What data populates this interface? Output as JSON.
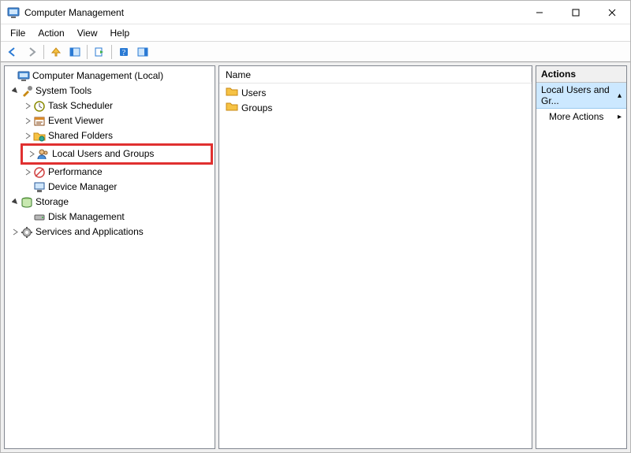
{
  "window": {
    "title": "Computer Management"
  },
  "menu": {
    "file": "File",
    "action": "Action",
    "view": "View",
    "help": "Help"
  },
  "tree": {
    "root": "Computer Management (Local)",
    "system_tools": "System Tools",
    "task_scheduler": "Task Scheduler",
    "event_viewer": "Event Viewer",
    "shared_folders": "Shared Folders",
    "local_users_groups": "Local Users and Groups",
    "performance": "Performance",
    "device_manager": "Device Manager",
    "storage": "Storage",
    "disk_management": "Disk Management",
    "services_apps": "Services and Applications"
  },
  "list": {
    "col_name": "Name",
    "items": {
      "users": "Users",
      "groups": "Groups"
    }
  },
  "actions": {
    "header": "Actions",
    "section": "Local Users and Gr...",
    "more": "More Actions"
  }
}
